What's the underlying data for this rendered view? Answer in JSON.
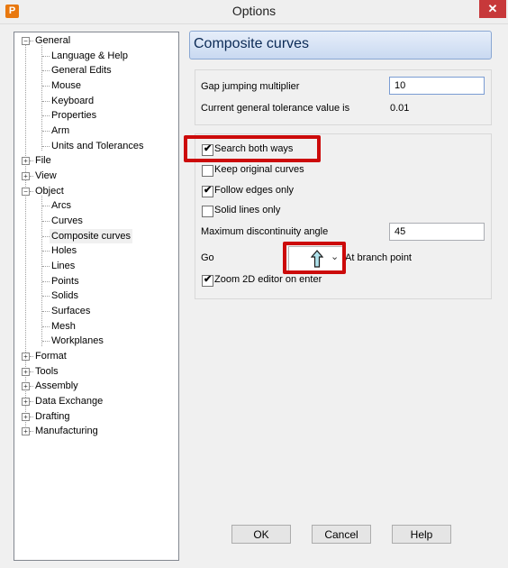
{
  "window": {
    "title": "Options",
    "app_icon_letter": "P",
    "close_glyph": "✕"
  },
  "tree": [
    {
      "label": "General",
      "expander": "−"
    },
    {
      "label": "Language & Help"
    },
    {
      "label": "General Edits"
    },
    {
      "label": "Mouse"
    },
    {
      "label": "Keyboard"
    },
    {
      "label": "Properties"
    },
    {
      "label": "Arm"
    },
    {
      "label": "Units and Tolerances"
    },
    {
      "label": "File",
      "expander": "+"
    },
    {
      "label": "View",
      "expander": "+"
    },
    {
      "label": "Object",
      "expander": "−"
    },
    {
      "label": "Arcs"
    },
    {
      "label": "Curves"
    },
    {
      "label": "Composite curves",
      "selected": true
    },
    {
      "label": "Holes"
    },
    {
      "label": "Lines"
    },
    {
      "label": "Points"
    },
    {
      "label": "Solids"
    },
    {
      "label": "Surfaces"
    },
    {
      "label": "Mesh"
    },
    {
      "label": "Workplanes"
    },
    {
      "label": "Format",
      "expander": "+"
    },
    {
      "label": "Tools",
      "expander": "+"
    },
    {
      "label": "Assembly",
      "expander": "+"
    },
    {
      "label": "Data Exchange",
      "expander": "+"
    },
    {
      "label": "Drafting",
      "expander": "+"
    },
    {
      "label": "Manufacturing",
      "expander": "+"
    }
  ],
  "panel": {
    "title": "Composite curves",
    "gap_label": "Gap jumping multiplier",
    "gap_value": "10",
    "tolerance_label": "Current general tolerance value is",
    "tolerance_value": "0.01",
    "checkboxes": [
      {
        "label": "Search both ways",
        "checked": true
      },
      {
        "label": "Keep original curves",
        "checked": false
      },
      {
        "label": "Follow edges only",
        "checked": true
      },
      {
        "label": "Solid lines only",
        "checked": false
      }
    ],
    "max_angle_label": "Maximum discontinuity angle",
    "max_angle_value": "45",
    "go_label": "Go",
    "go_direction_icon": "arrow-up-icon",
    "go_dropdown_chevron": "⌄",
    "at_branch_label": "At branch point",
    "zoom_label": "Zoom 2D editor on enter",
    "zoom_checked": true,
    "check_glyph": "✔"
  },
  "buttons": {
    "ok": "OK",
    "cancel": "Cancel",
    "help": "Help"
  },
  "colors": {
    "highlight_red": "#cc0a0a",
    "accent_blue": "#7a9cd3",
    "arrow_fill": "#aee0ea"
  }
}
